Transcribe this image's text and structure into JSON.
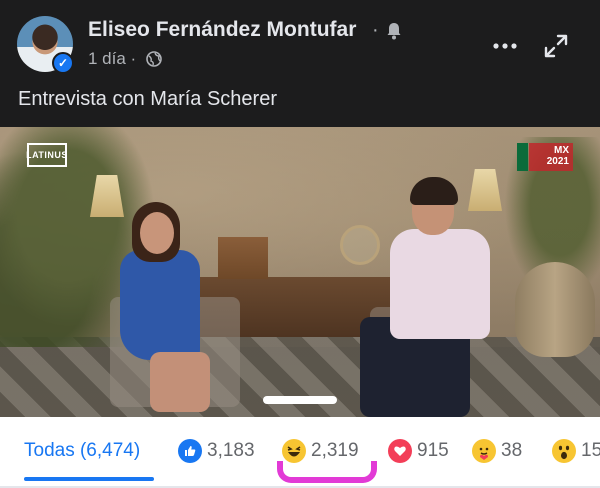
{
  "post": {
    "author_name": "Eliseo Fernández Montufar",
    "separator": "·",
    "time": "1 día",
    "time_separator": "·",
    "text": "Entrevista con María Scherer"
  },
  "video": {
    "channel_logo": "LATINUS",
    "event_logo_line1": "MX",
    "event_logo_line2": "2021"
  },
  "reactions": {
    "all_label": "Todas (6,474)",
    "items": [
      {
        "type": "like",
        "icon": "thumbs-up-icon",
        "count": "3,183"
      },
      {
        "type": "haha",
        "icon": "laughing-face-icon",
        "count": "2,319"
      },
      {
        "type": "love",
        "icon": "heart-icon",
        "count": "915"
      },
      {
        "type": "care",
        "icon": "hugging-face-icon",
        "count": "38"
      },
      {
        "type": "wow",
        "icon": "surprised-face-icon",
        "count": "15"
      }
    ]
  },
  "colors": {
    "accent": "#1877f2",
    "highlight": "#e23ad6",
    "dark_bg": "#1c1c1d"
  }
}
